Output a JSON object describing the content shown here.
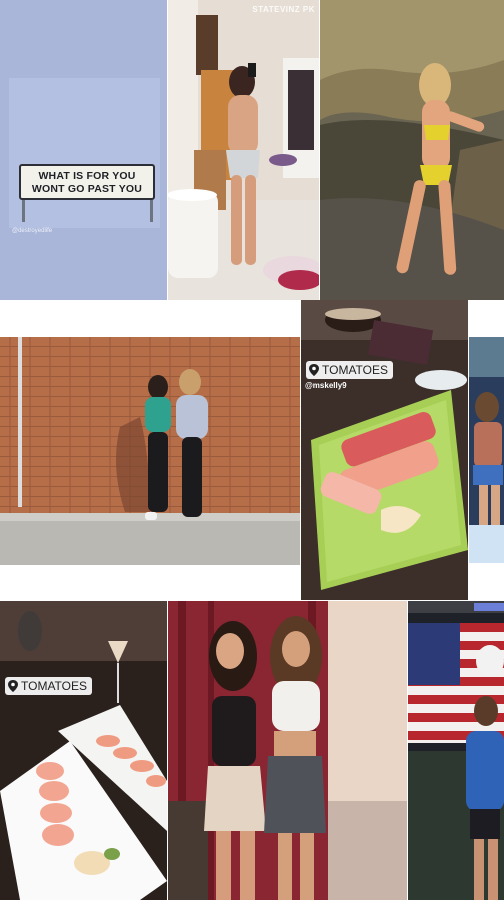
{
  "collage": {
    "tile1": {
      "sign_line1": "WHAT IS FOR YOU",
      "sign_line2": "WONT GO PAST YOU",
      "handle": "@destroyedlife"
    },
    "tile2": {
      "watermark": "STATEVINZ PK"
    },
    "tile5": {
      "location": "TOMATOES",
      "mention": "@mskelly9"
    },
    "tile7": {
      "location": "TOMATOES"
    }
  },
  "colors": {
    "sky": "#a9b6d9",
    "brick": "#b66e49",
    "curtain": "#7b1f2a",
    "plate_green": "#a7cf55"
  },
  "icons": [
    "location-pin-icon"
  ]
}
